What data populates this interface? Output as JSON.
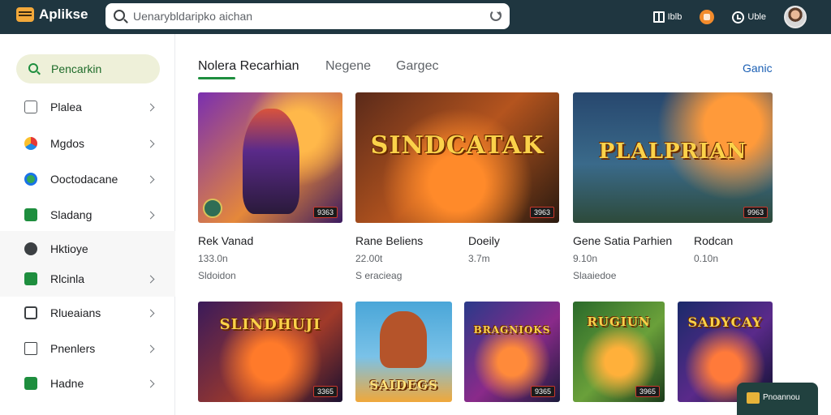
{
  "app": {
    "title": "Aplikse"
  },
  "search": {
    "placeholder": "Uenarybldaripko aichan"
  },
  "header_actions": [
    {
      "icon": "book-icon",
      "label": "Iblb"
    },
    {
      "icon": "game-icon",
      "label": ""
    },
    {
      "icon": "clock-icon",
      "label": "Uble"
    }
  ],
  "sidebar": {
    "search_label": "Pencarkin",
    "items": [
      {
        "label": "Plalea",
        "icon": "camera-icon",
        "has_chevron": true
      },
      {
        "label": "Mgdos",
        "icon": "colorful-dots-icon",
        "has_chevron": true
      },
      {
        "label": "Ooctodacane",
        "icon": "ring-icon",
        "has_chevron": true
      },
      {
        "label": "Sladang",
        "icon": "green-square-icon",
        "has_chevron": true
      },
      {
        "label": "Hktioye",
        "icon": "dark-dot-icon",
        "has_chevron": false
      },
      {
        "label": "Rlcinla",
        "icon": "grid-icon",
        "has_chevron": true
      },
      {
        "label": "Rlueaians",
        "icon": "document-icon",
        "has_chevron": true
      },
      {
        "label": "Pnenlers",
        "icon": "outline-square-icon",
        "has_chevron": true
      },
      {
        "label": "Hadne",
        "icon": "green-square-icon",
        "has_chevron": true
      }
    ]
  },
  "tabs": [
    {
      "label": "Nolera Recarhian",
      "active": true
    },
    {
      "label": "Negene",
      "active": false
    },
    {
      "label": "Gargeс",
      "active": false
    }
  ],
  "see_all_label": "Ganic",
  "featured": [
    {
      "thumb_title": "",
      "badge": "9363",
      "name": "Rek Vanad",
      "extra_name": "",
      "size": "133.0n",
      "extra_size": "",
      "publisher": "Sldoidon"
    },
    {
      "thumb_title": "SINDCATAK",
      "badge": "3963",
      "name": "Rane Beliens",
      "extra_name": "Doeily",
      "size": "22.00t",
      "extra_size": "3.7m",
      "publisher": "S eracieag"
    },
    {
      "thumb_title": "PLALPRIAN",
      "badge": "9963",
      "name": "Gene Satia Parhien",
      "extra_name": "Rodcan",
      "size": "9.10n",
      "extra_size": "0.10n",
      "publisher": "Slaaiedoe"
    }
  ],
  "row2": [
    {
      "thumb_title": "SLINDHUJI",
      "badge": "3365"
    },
    {
      "thumb_title": "SAIDEGS",
      "badge": ""
    },
    {
      "thumb_title": "BRAGNIOKS",
      "badge": "9365"
    },
    {
      "thumb_title": "RUGIUN",
      "badge": "3965"
    },
    {
      "thumb_title": "SADYCAY",
      "badge": ""
    }
  ],
  "toast": {
    "label": "Pnoannou"
  },
  "colors": {
    "topbar": "#1f3640",
    "accent_green": "#1e8e3e",
    "sidebar_search_bg": "#eef0d9"
  }
}
